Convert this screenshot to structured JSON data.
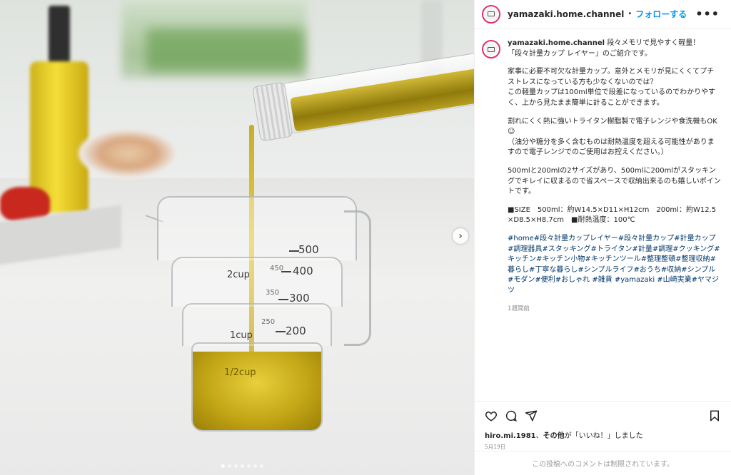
{
  "post": {
    "username": "yamazaki.home.channel",
    "separator": "•",
    "follow_label": "フォローする",
    "more_label": "•••"
  },
  "media": {
    "scale_marks": {
      "m500": "500",
      "m400": "400",
      "m300": "300",
      "m200": "200",
      "m450": "450",
      "m350": "350",
      "m250": "250",
      "cup2": "2cup",
      "cup1": "1cup",
      "cup_half": "1/2cup"
    },
    "next_arrow": "›",
    "dots_count": 7,
    "active_dot": 0
  },
  "caption": {
    "username": "yamazaki.home.channel",
    "p1": "段々メモリで見やすく軽量！「段々計量カップ レイヤー」のご紹介です。",
    "p2": "家事に必要不可欠な計量カップ。意外とメモリが見にくくてプチストレスになっている方も少なくないのでは？\nこの軽量カップは100ml単位で段差になっているのでわかりやすく、上から見たまま簡単に計ることができます。",
    "p3": "割れにくく熱に強いトライタン樹脂製で電子レンジや食洗機もOK☺\n（油分や糖分を多く含むものは耐熱温度を超える可能性がありますので電子レンジでのご使用はお控えください。）",
    "p4": "500mlと200mlの2サイズがあり、500mlに200mlがスタッキングでキレイに収まるので省スペースで収納出来るのも嬉しいポイントです。",
    "p5": "■SIZE　500ml：約W14.5×D11×H12cm　200ml：約W12.5×D8.5×H8.7cm　■耐熱温度：100℃",
    "tags": "#home#段々計量カップレイヤー#段々計量カップ#計量カップ#調理器具#スタッキング#トライタン#計量#調理#クッキング#キッチン#キッチン小物#キッチンツール#整理整頓#整理収納#暮らし#丁寧な暮らし#シンプルライフ#おうち#収納#シンプル#モダン#便利#おしゃれ #雑貨 #yamazaki #山崎実業#ヤマジツ",
    "time": "1週間前"
  },
  "likes": {
    "user": "hiro.mi.1981",
    "mid": "、",
    "others": "その他",
    "suffix": "が「いいね！」しました"
  },
  "date": "5月19日",
  "comments_disabled": "この投稿へのコメントは制限されています。"
}
